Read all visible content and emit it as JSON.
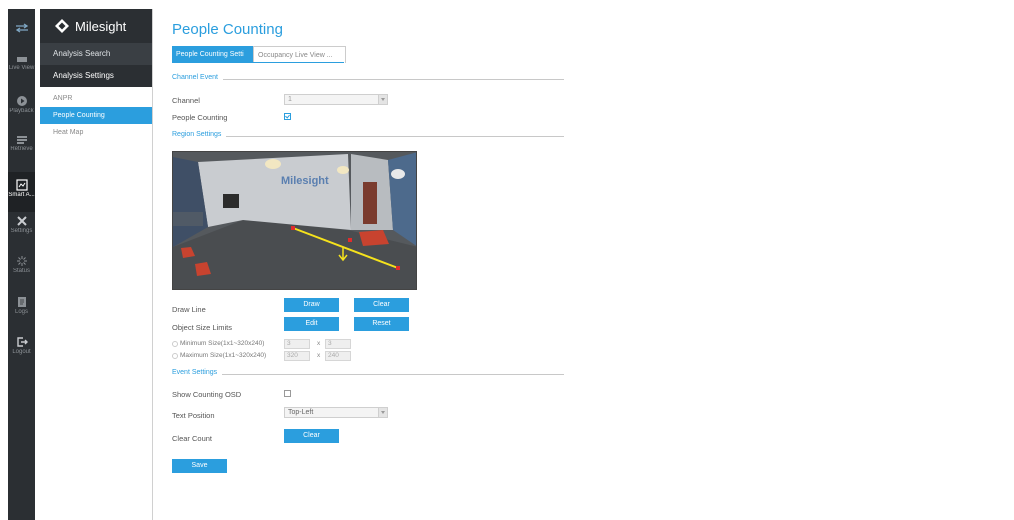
{
  "colors": {
    "accent": "#2b9ede",
    "rail_bg": "#2b2f33",
    "line": "#f5e21c"
  },
  "rail": [
    {
      "icon": "exchange-arrows-icon",
      "label": ""
    },
    {
      "icon": "live-view-icon",
      "label": "Live View"
    },
    {
      "icon": "playback-icon",
      "label": "Playback"
    },
    {
      "icon": "retrieve-icon",
      "label": "Retrieve"
    },
    {
      "icon": "smart-analysis-icon",
      "label": "Smart A..."
    },
    {
      "icon": "settings-wrench-icon",
      "label": "Settings"
    },
    {
      "icon": "status-icon",
      "label": "Status"
    },
    {
      "icon": "logs-icon",
      "label": "Logs"
    },
    {
      "icon": "logout-icon",
      "label": "Logout"
    }
  ],
  "brand": {
    "name": "Milesight"
  },
  "nav": {
    "analysis_search": "Analysis Search",
    "analysis_settings": "Analysis Settings",
    "items": [
      "ANPR",
      "People Counting",
      "Heat Map"
    ]
  },
  "page": {
    "title": "People Counting",
    "tabs": [
      "People Counting Setti",
      "Occupancy Live View ..."
    ]
  },
  "channel_event": {
    "title": "Channel Event",
    "channel_label": "Channel",
    "channel_value": "1",
    "people_counting_label": "People Counting",
    "people_counting_checked": true
  },
  "region_settings": {
    "title": "Region Settings",
    "camera_brand_text": "Milesight",
    "draw_line_label": "Draw Line",
    "draw_button": "Draw",
    "clear_button": "Clear",
    "object_size_label": "Object Size Limits",
    "edit_button": "Edit",
    "reset_button": "Reset",
    "min_size_label": "Minimum Size(1x1~320x240)",
    "min_w": "3",
    "min_h": "3",
    "max_size_label": "Maximum Size(1x1~320x240)",
    "max_w": "320",
    "max_h": "240",
    "times": "x"
  },
  "event_settings": {
    "title": "Event Settings",
    "show_osd_label": "Show Counting OSD",
    "show_osd_checked": false,
    "text_position_label": "Text Position",
    "text_position_value": "Top-Left",
    "clear_count_label": "Clear Count",
    "clear_button": "Clear"
  },
  "save_button": "Save"
}
